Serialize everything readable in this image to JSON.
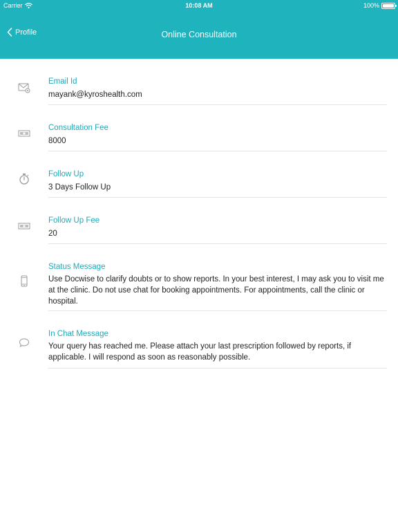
{
  "status_bar": {
    "carrier": "Carrier",
    "time": "10:08 AM",
    "battery": "100%"
  },
  "nav": {
    "back_label": "Profile",
    "title": "Online Consultation"
  },
  "fields": [
    {
      "label": "Email Id",
      "value": "mayank@kyroshealth.com",
      "icon": "envelope-icon"
    },
    {
      "label": "Consultation Fee",
      "value": "8000",
      "icon": "money-icon"
    },
    {
      "label": "Follow Up",
      "value": "3 Days Follow Up",
      "icon": "stopwatch-icon"
    },
    {
      "label": "Follow Up Fee",
      "value": "20",
      "icon": "money-icon"
    },
    {
      "label": "Status Message",
      "value": "Use Docwise to clarify doubts or to show reports. In your best interest, I may ask you to visit me at the clinic. Do not use chat for booking appointments. For appointments, call the clinic or hospital.",
      "icon": "phone-icon"
    },
    {
      "label": "In Chat Message",
      "value": "Your query has reached me. Please attach your last prescription followed by reports, if applicable. I will respond as soon as reasonably possible.",
      "icon": "chat-bubble-icon"
    }
  ],
  "colors": {
    "header": "#1fb3be",
    "label": "#1fa9b6",
    "divider": "#e3e3e3"
  }
}
